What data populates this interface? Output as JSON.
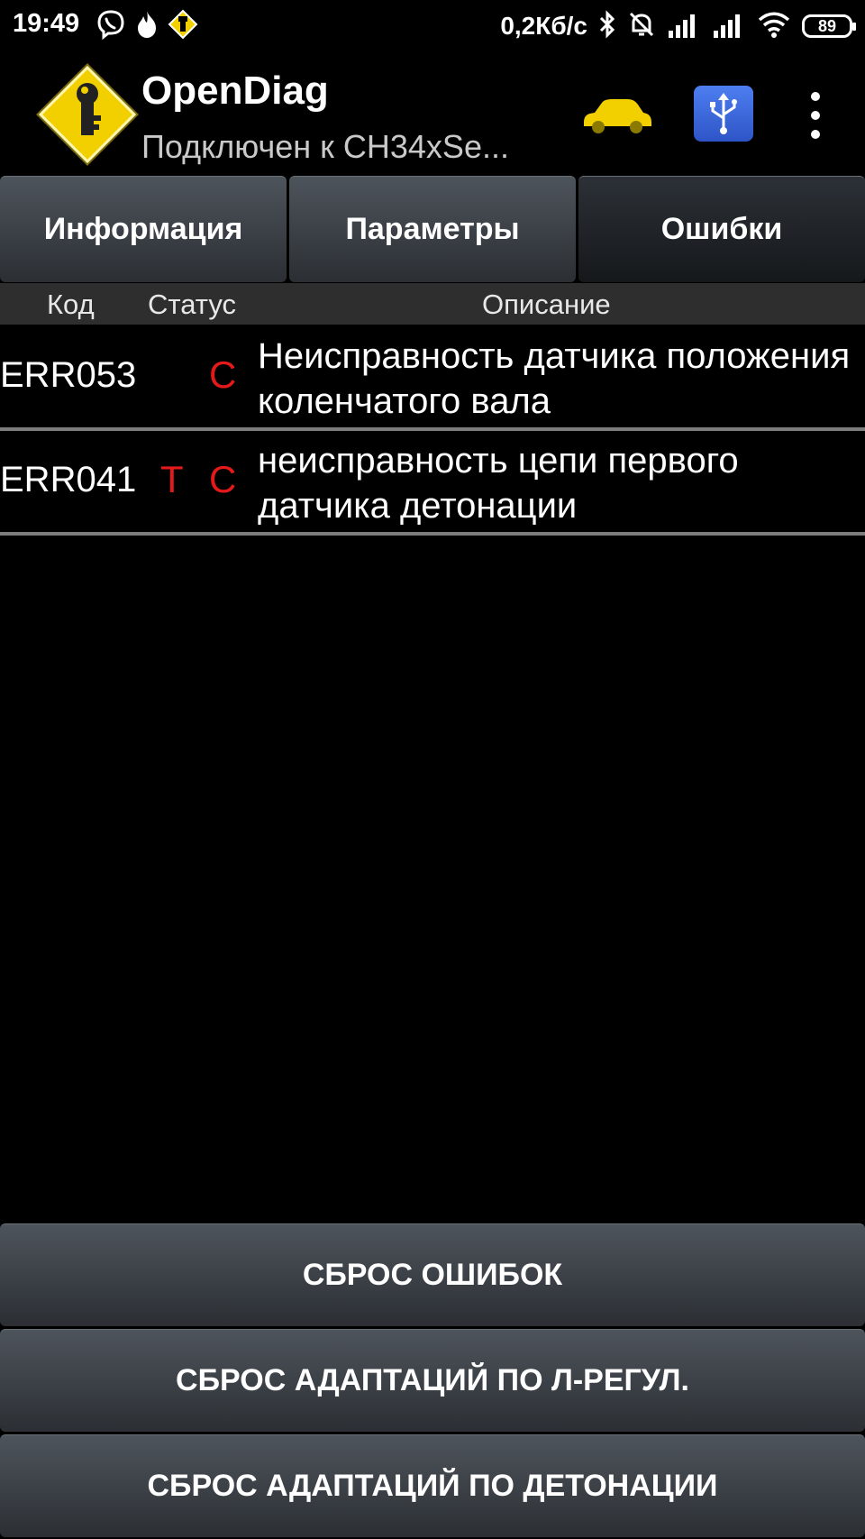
{
  "status_bar": {
    "time": "19:49",
    "speed": "0,2Кб/с",
    "battery": "89",
    "left_icons": [
      "viber-icon",
      "fire-icon",
      "opendiag-notification-icon"
    ],
    "right_icons": [
      "bluetooth-icon",
      "alarm-off-icon",
      "signal-icon",
      "signal-icon",
      "wifi-icon",
      "battery-icon"
    ]
  },
  "app_bar": {
    "title": "OpenDiag",
    "subtitle": "Подключен к CH34xSe...",
    "icons": [
      "app-logo-icon",
      "car-icon",
      "usb-icon",
      "overflow-menu-icon"
    ]
  },
  "tabs": [
    {
      "label": "Информация",
      "active": false
    },
    {
      "label": "Параметры",
      "active": false
    },
    {
      "label": "Ошибки",
      "active": true
    }
  ],
  "table": {
    "headers": {
      "code": "Код",
      "status": "Статус",
      "description": "Описание"
    },
    "rows": [
      {
        "code": "ERR053",
        "status_t": "",
        "status_c": "С",
        "description": "Неисправность датчика положения коленчатого вала"
      },
      {
        "code": "ERR041",
        "status_t": "Т",
        "status_c": "С",
        "description": "неисправность цепи первого датчика детонации"
      }
    ]
  },
  "buttons": {
    "reset_errors": "СБРОС ОШИБОК",
    "reset_lambda": "СБРОС АДАПТАЦИЙ ПО Л-РЕГУЛ.",
    "reset_knock": "СБРОС АДАПТАЦИЙ ПО ДЕТОНАЦИИ"
  },
  "colors": {
    "background": "#000000",
    "status_red": "#e41a1a",
    "logo_yellow": "#f2d000",
    "usb_blue": "#3b66dc"
  }
}
